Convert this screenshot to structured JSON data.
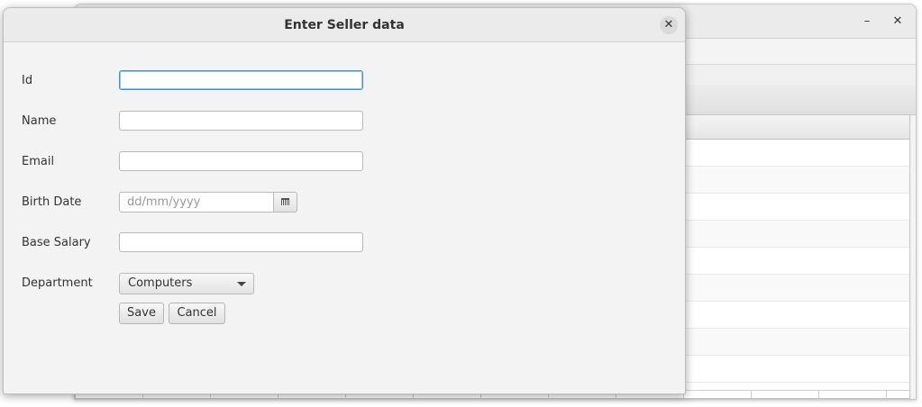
{
  "main_window": {
    "minimize_icon": "minimize-icon",
    "close_icon": "close-icon",
    "minimize_glyph": "–",
    "close_glyph": "✕"
  },
  "dialog": {
    "title": "Enter Seller data",
    "close_glyph": "✕",
    "fields": {
      "id": {
        "label": "Id",
        "value": ""
      },
      "name": {
        "label": "Name",
        "value": ""
      },
      "email": {
        "label": "Email",
        "value": ""
      },
      "birth_date": {
        "label": "Birth Date",
        "value": "",
        "placeholder": "dd/mm/yyyy"
      },
      "base_salary": {
        "label": "Base Salary",
        "value": ""
      },
      "department": {
        "label": "Department",
        "selected": "Computers"
      }
    },
    "buttons": {
      "save": "Save",
      "cancel": "Cancel"
    }
  },
  "colors": {
    "focus_border": "#3d94d8",
    "dialog_bg": "#f3f3f3",
    "titlebar_bg": "#ebebeb"
  }
}
